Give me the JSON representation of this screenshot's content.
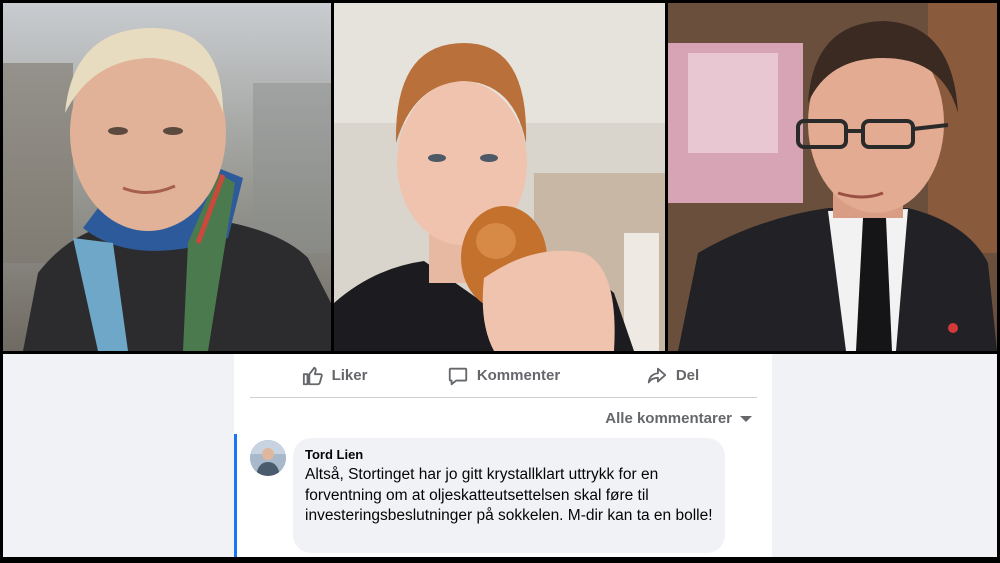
{
  "photos": [
    {
      "subject": "man-with-striped-scarf"
    },
    {
      "subject": "young-man-holding-bun"
    },
    {
      "subject": "man-with-glasses-in-suit"
    }
  ],
  "post_actions": [
    {
      "label": "Liker",
      "icon": "thumbs-up-icon"
    },
    {
      "label": "Kommenter",
      "icon": "comment-icon"
    },
    {
      "label": "Del",
      "icon": "share-icon"
    }
  ],
  "comments_filter": {
    "label": "Alle kommentarer",
    "icon": "caret-down-icon"
  },
  "comment": {
    "author": "Tord Lien",
    "text": "Altså, Stortinget har jo gitt krystallklart uttrykk for en forventning om at oljeskatteutsettelsen skal føre til investeringsbeslutninger på sokkelen. M-dir kan ta en bolle!"
  },
  "colors": {
    "action_text": "#65676b",
    "bubble_bg": "#f0f2f5",
    "thread_line": "#1877f2",
    "page_bg": "#f0f2f5"
  }
}
